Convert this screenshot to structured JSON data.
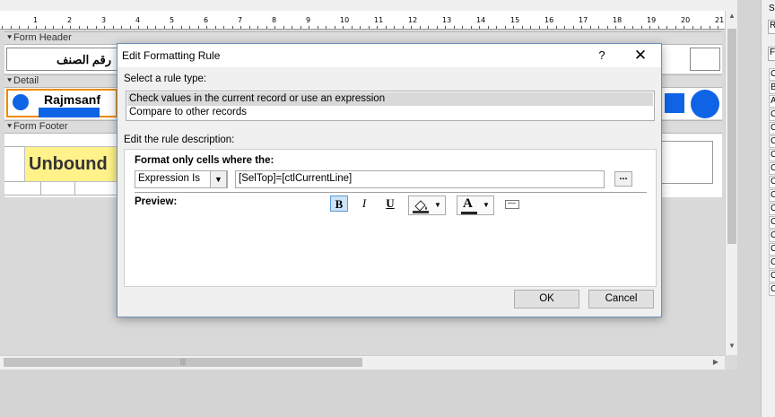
{
  "ruler": {
    "marks": [
      "1",
      "2",
      "3",
      "4",
      "5",
      "6",
      "7",
      "8",
      "9",
      "10",
      "11",
      "12",
      "13",
      "14",
      "15",
      "16",
      "17",
      "18",
      "19",
      "20",
      "21"
    ]
  },
  "sections": {
    "form_header": "Form Header",
    "detail": "Detail",
    "form_footer": "Form Footer"
  },
  "form": {
    "header_label": "رقم الصنف",
    "detail_text": "Rajmsanf",
    "footer_unbound": "Unbound"
  },
  "dialog": {
    "title": "Edit Formatting Rule",
    "help_label": "?",
    "close_label": "✕",
    "select_rule_label": "Select a rule type:",
    "rule_types": [
      "Check values in the current record or use an expression",
      "Compare to other records"
    ],
    "selected_rule_index": 0,
    "edit_rule_label": "Edit the rule description:",
    "format_only_label": "Format only cells where the:",
    "condition_type": "Expression Is",
    "expression": "[SelTop]=[ctlCurrentLine]",
    "builder_label": "...",
    "preview_label": "Preview:",
    "bold_label": "B",
    "italic_label": "I",
    "underline_label": "U",
    "font_color_label": "A",
    "ok_label": "OK",
    "cancel_label": "Cancel"
  },
  "right_panel": {
    "top_letters": [
      "Se",
      "R",
      "Fo"
    ],
    "items": [
      "C",
      "B",
      "A",
      "C",
      "C",
      "C",
      "C",
      "C",
      "C",
      "C",
      "C",
      "C",
      "C",
      "C",
      "C",
      "C",
      "C"
    ]
  },
  "colors": {
    "unbound_bg": "#fff28a",
    "detail_blue": "#0f64e6",
    "dialog_border": "#6a8fb8",
    "selected_rule_bg": "#d9d9d9"
  }
}
